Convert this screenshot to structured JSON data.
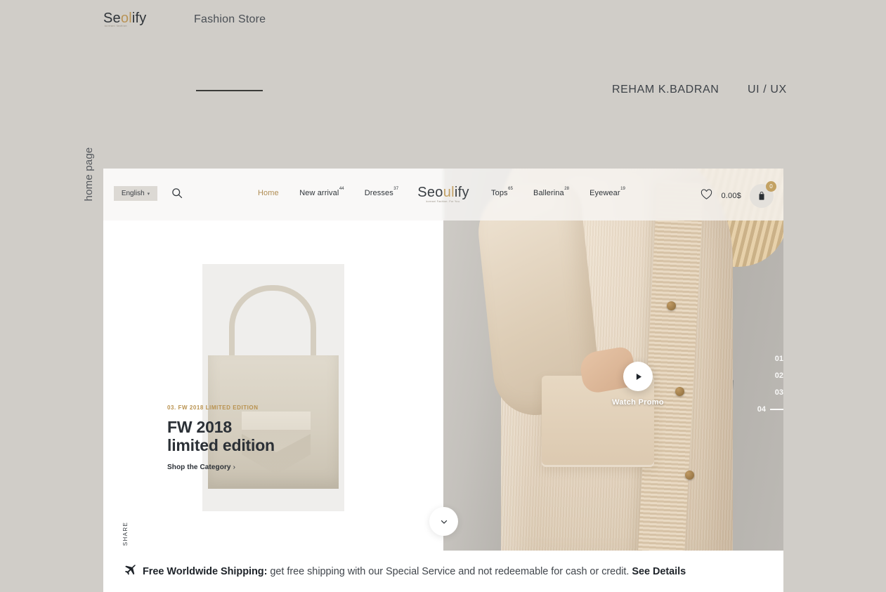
{
  "presentation": {
    "brand_logo": {
      "pre": "Se",
      "mid": "ol",
      "post": "ify",
      "tagline": "koreani fashion"
    },
    "section_label": "Fashion Store",
    "author": "REHAM K.BADRAN",
    "role": "UI / UX",
    "page_label": "home page"
  },
  "site": {
    "language": {
      "label": "English",
      "chevron": "▾"
    },
    "search_icon": "search-icon",
    "nav_left": [
      {
        "label": "Home",
        "count": "",
        "active": true
      },
      {
        "label": "New arrival",
        "count": "44",
        "active": false
      },
      {
        "label": "Dresses",
        "count": "37",
        "active": false
      }
    ],
    "logo": {
      "pre": "Seo",
      "mid": "ul",
      "post": "ify",
      "tagline": "koreani Fashion. For You."
    },
    "nav_right": [
      {
        "label": "Tops",
        "count": "65",
        "active": false
      },
      {
        "label": "Ballerina",
        "count": "28",
        "active": false
      },
      {
        "label": "Eyewear",
        "count": "19",
        "active": false
      }
    ],
    "actions": {
      "wishlist_icon": "heart-icon",
      "cart_total": "0.00$",
      "bag_icon": "shopping-bag-icon",
      "bag_badge": "0"
    }
  },
  "hero": {
    "kicker": "03. FW 2018 LIMITED EDITION",
    "title_line1": "FW 2018",
    "title_line2": "limited edition",
    "cta": "Shop the Category",
    "cta_arrow": "›",
    "share_label": "SHARE",
    "add_icon": "+",
    "scroll_icon": "chevron-down-icon",
    "play_icon": "play-icon",
    "play_label": "Watch Promo",
    "slides": [
      {
        "num": "01",
        "active": false
      },
      {
        "num": "02",
        "active": false
      },
      {
        "num": "03",
        "active": false
      },
      {
        "num": "04",
        "active": true
      }
    ]
  },
  "shipping": {
    "icon": "airplane-icon",
    "bold": "Free Worldwide Shipping:",
    "text": " get free shipping with our Special Service and not redeemable for cash or credit. ",
    "link": "See Details"
  },
  "colors": {
    "page_bg": "#d0cdc8",
    "accent_gold": "#b9924f",
    "ink": "#2b3036"
  }
}
